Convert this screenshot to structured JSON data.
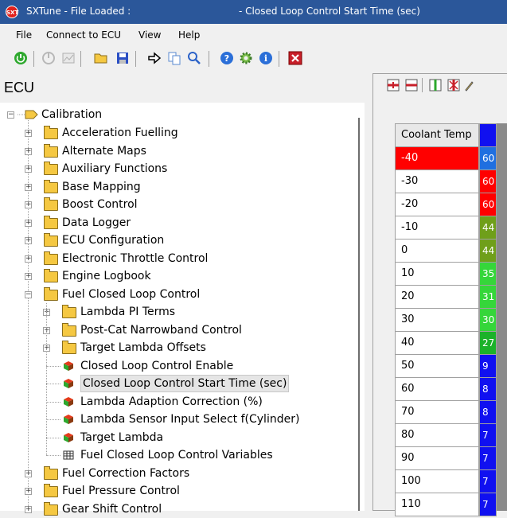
{
  "window": {
    "app_name": "SXTune - File Loaded :",
    "document_title": "- Closed Loop Control Start Time (sec)",
    "app_icon_text": "SXT"
  },
  "menu": [
    "File",
    "Connect to ECU",
    "View",
    "Help"
  ],
  "toolbar": {
    "icons": [
      "power-icon",
      "disconnect-icon",
      "chart-icon",
      "open-folder-icon",
      "save-icon",
      "arrow-icon",
      "copy-icon",
      "search-icon",
      "help-icon",
      "settings-icon",
      "info-icon",
      "close-icon"
    ]
  },
  "ecu_panel": {
    "header": "ECU",
    "root": "Calibration",
    "items": [
      {
        "label": "Acceleration Fuelling",
        "type": "folder",
        "level": 1
      },
      {
        "label": "Alternate Maps",
        "type": "folder",
        "level": 1
      },
      {
        "label": "Auxiliary Functions",
        "type": "folder",
        "level": 1
      },
      {
        "label": "Base Mapping",
        "type": "folder",
        "level": 1
      },
      {
        "label": "Boost Control",
        "type": "folder",
        "level": 1
      },
      {
        "label": "Data Logger",
        "type": "folder",
        "level": 1
      },
      {
        "label": "ECU Configuration",
        "type": "folder",
        "level": 1
      },
      {
        "label": "Electronic Throttle Control",
        "type": "folder",
        "level": 1
      },
      {
        "label": "Engine Logbook",
        "type": "folder",
        "level": 1
      },
      {
        "label": "Fuel Closed Loop Control",
        "type": "folder",
        "level": 1,
        "expanded": true
      },
      {
        "label": "Lambda PI Terms",
        "type": "folder",
        "level": 2
      },
      {
        "label": "Post-Cat Narrowband Control",
        "type": "folder",
        "level": 2
      },
      {
        "label": "Target Lambda Offsets",
        "type": "folder",
        "level": 2
      },
      {
        "label": "Closed Loop Control Enable",
        "type": "cube",
        "level": 2
      },
      {
        "label": "Closed Loop Control Start Time (sec)",
        "type": "cube",
        "level": 2,
        "selected": true
      },
      {
        "label": "Lambda Adaption Correction (%)",
        "type": "cube",
        "level": 2
      },
      {
        "label": "Lambda Sensor Input Select f(Cylinder)",
        "type": "cube",
        "level": 2
      },
      {
        "label": "Target Lambda",
        "type": "cube",
        "level": 2
      },
      {
        "label": "Fuel Closed Loop Control Variables",
        "type": "table",
        "level": 2
      },
      {
        "label": "Fuel Correction Factors",
        "type": "folder",
        "level": 1
      },
      {
        "label": "Fuel Pressure Control",
        "type": "folder",
        "level": 1
      },
      {
        "label": "Gear Shift Control",
        "type": "folder",
        "level": 1
      }
    ]
  },
  "table": {
    "column_header": "Coolant Temp",
    "rows": [
      {
        "temp": "-40",
        "value": "60",
        "color": "#1f6fe0",
        "selected": true
      },
      {
        "temp": "-30",
        "value": "60",
        "color": "#ff0000"
      },
      {
        "temp": "-20",
        "value": "60",
        "color": "#ff0000"
      },
      {
        "temp": "-10",
        "value": "44",
        "color": "#6f9f1a"
      },
      {
        "temp": "0",
        "value": "44",
        "color": "#6f9f1a"
      },
      {
        "temp": "10",
        "value": "35",
        "color": "#35d63a"
      },
      {
        "temp": "20",
        "value": "31",
        "color": "#35d63a"
      },
      {
        "temp": "30",
        "value": "30",
        "color": "#35d63a"
      },
      {
        "temp": "40",
        "value": "27",
        "color": "#1bb22a"
      },
      {
        "temp": "50",
        "value": "9",
        "color": "#1010f0"
      },
      {
        "temp": "60",
        "value": "8",
        "color": "#1010f0"
      },
      {
        "temp": "70",
        "value": "8",
        "color": "#1010f0"
      },
      {
        "temp": "80",
        "value": "7",
        "color": "#1010f0"
      },
      {
        "temp": "90",
        "value": "7",
        "color": "#1010f0"
      },
      {
        "temp": "100",
        "value": "7",
        "color": "#1010f0"
      },
      {
        "temp": "110",
        "value": "7",
        "color": "#1010f0"
      }
    ]
  }
}
